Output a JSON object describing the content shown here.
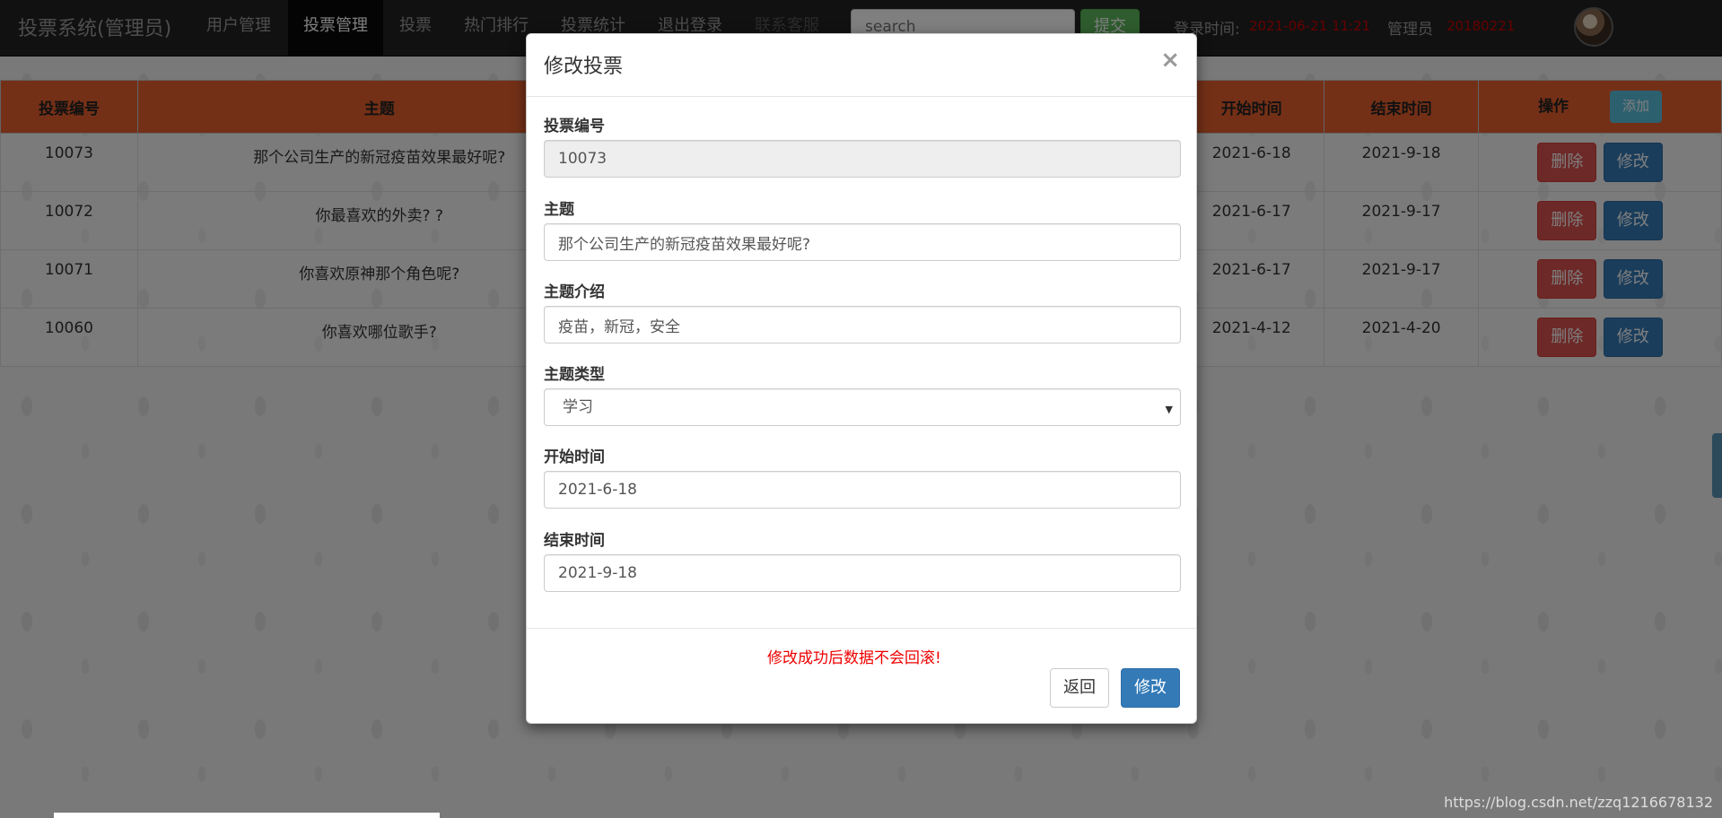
{
  "navbar": {
    "brand": "投票系统(管理员)",
    "items": [
      {
        "label": "用户管理",
        "active": false
      },
      {
        "label": "投票管理",
        "active": true
      },
      {
        "label": "投票",
        "active": false
      },
      {
        "label": "热门排行",
        "active": false
      },
      {
        "label": "投票统计",
        "active": false
      },
      {
        "label": "退出登录",
        "active": false
      },
      {
        "label": "联系客服",
        "active": false
      }
    ],
    "search_placeholder": "search",
    "search_button": "提交",
    "login_time_label": "登录时间:",
    "login_time_value": "2021-06-21 11:21",
    "admin_label": "管理员",
    "admin_id": "20180221"
  },
  "table": {
    "headers": [
      "投票编号",
      "主题",
      "开始时间",
      "结束时间",
      "操作"
    ],
    "add_label": "添加",
    "delete_label": "删除",
    "edit_label": "修改",
    "rows": [
      {
        "id": "10073",
        "topic": "那个公司生产的新冠疫苗效果最好呢?",
        "start": "2021-6-18",
        "end": "2021-9-18"
      },
      {
        "id": "10072",
        "topic": "你最喜欢的外卖? ?",
        "start": "2021-6-17",
        "end": "2021-9-17"
      },
      {
        "id": "10071",
        "topic": "你喜欢原神那个角色呢?",
        "start": "2021-6-17",
        "end": "2021-9-17"
      },
      {
        "id": "10060",
        "topic": "你喜欢哪位歌手?",
        "start": "2021-4-12",
        "end": "2021-4-20"
      }
    ]
  },
  "modal": {
    "title": "修改投票",
    "close": "×",
    "fields": {
      "id": {
        "label": "投票编号",
        "value": "10073"
      },
      "topic": {
        "label": "主题",
        "value": "那个公司生产的新冠疫苗效果最好呢?"
      },
      "intro": {
        "label": "主题介绍",
        "value": "疫苗，新冠，安全"
      },
      "type": {
        "label": "主题类型",
        "value": "学习"
      },
      "start": {
        "label": "开始时间",
        "value": "2021-6-18"
      },
      "end": {
        "label": "结束时间",
        "value": "2021-9-18"
      }
    },
    "warning": "修改成功后数据不会回滚!",
    "back_button": "返回",
    "submit_button": "修改"
  },
  "watermark": "https://blog.csdn.net/zzq1216678132",
  "colors": {
    "navbar_bg": "#222222",
    "table_header": "#e8612e",
    "danger": "#d9534f",
    "primary": "#337ab7",
    "success": "#5cb85c",
    "info": "#5bc0de",
    "warning_text": "#ee0000"
  }
}
